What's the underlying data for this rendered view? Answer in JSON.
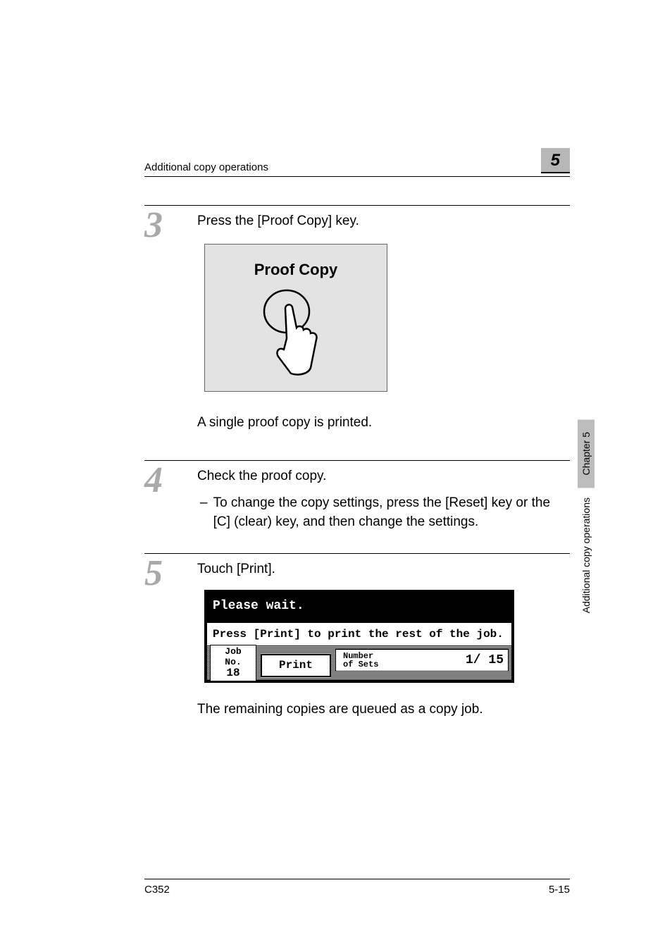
{
  "header": {
    "title": "Additional copy operations",
    "chapter_number": "5"
  },
  "side": {
    "chapter": "Chapter 5",
    "label": "Additional copy operations"
  },
  "steps": [
    {
      "num": "3",
      "instruction": "Press the [Proof Copy] key.",
      "proof_label": "Proof Copy",
      "result": "A single proof copy is printed."
    },
    {
      "num": "4",
      "instruction": "Check the proof copy.",
      "bullet": "To change the copy settings, press the [Reset] key or the [C] (clear) key, and then change the settings."
    },
    {
      "num": "5",
      "instruction": "Touch [Print].",
      "lcd": {
        "header": "Please wait.",
        "instr": "Press [Print] to print the rest of the job.",
        "job_label": "Job\nNo.",
        "job_value": "18",
        "print_btn": "Print",
        "sets_label": "Number\nof Sets",
        "sets_value": "1/  15"
      },
      "result": "The remaining copies are queued as a copy job."
    }
  ],
  "footer": {
    "left": "C352",
    "right": "5-15"
  }
}
